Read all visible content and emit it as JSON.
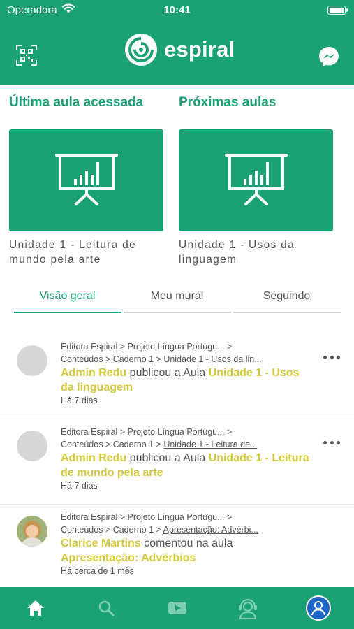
{
  "status_bar": {
    "carrier": "Operadora",
    "time": "10:41",
    "icons": [
      "wifi-icon",
      "battery-icon"
    ]
  },
  "header": {
    "app_name": "espiral",
    "left_icon": "qr-code-icon",
    "right_icon": "messenger-icon"
  },
  "last_lesson": {
    "title": "Última aula acessada",
    "caption": "Unidade 1 - Leitura de mundo pela arte",
    "icon": "presentation-chart-icon"
  },
  "next_lessons": {
    "title": "Próximas aulas",
    "caption": "Unidade 1 - Usos da linguagem",
    "icon": "presentation-chart-icon"
  },
  "tabs": [
    {
      "label": "Visão geral",
      "active": true
    },
    {
      "label": "Meu mural",
      "active": false
    },
    {
      "label": "Seguindo",
      "active": false
    }
  ],
  "feed": [
    {
      "crumb_line1": "Editora Espiral > Projeto Língua Portugu... >",
      "crumb_prefix": "Conteúdos > Caderno 1 > ",
      "crumb_link": "Unidade 1 - Usos da lin...",
      "author": "Admin Redu",
      "action": " publicou a Aula ",
      "target": "Unidade 1 - Usos da linguagem",
      "time": "Há 7 dias"
    },
    {
      "crumb_line1": "Editora Espiral > Projeto Língua Portugu... >",
      "crumb_prefix": "Conteúdos > Caderno 1 > ",
      "crumb_link": "Unidade 1 - Leitura de...",
      "author": "Admin Redu",
      "action": " publicou a Aula ",
      "target": "Unidade 1 - Leitura de mundo pela arte",
      "time": "Há 7 dias"
    },
    {
      "crumb_line1": "Editora Espiral > Projeto Língua Portugu... >",
      "crumb_prefix": "Conteúdos > Caderno 1 > ",
      "crumb_link": "Apresentação: Advérbi...",
      "author": "Clarice Martins",
      "action": " comentou na aula ",
      "target": "Apresentação: Advérbios",
      "time": "Há cerca de 1 mês"
    }
  ],
  "bottom_nav": [
    "home-icon",
    "search-icon",
    "video-icon",
    "support-agent-icon",
    "profile-icon"
  ],
  "colors": {
    "primary": "#1aa174",
    "highlight": "#d3c93a",
    "text": "#555555"
  }
}
